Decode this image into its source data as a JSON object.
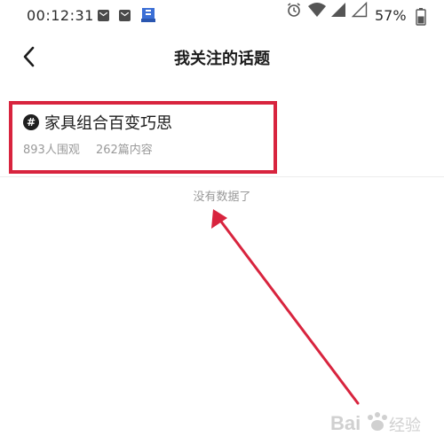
{
  "status_bar": {
    "time": "00:12:31",
    "battery_percent": "57%",
    "notification_icons": [
      "mail-icon",
      "mail-icon",
      "app-icon"
    ]
  },
  "header": {
    "title": "我关注的话题",
    "back_icon": "chevron-left-icon"
  },
  "topics": [
    {
      "title": "家具组合百变巧思",
      "watchers": "893人围观",
      "posts": "262篇内容"
    }
  ],
  "end_of_list_text": "没有数据了",
  "colors": {
    "annotation_red": "#d8243e",
    "muted_text": "#9a9a9a",
    "primary_text": "#1c1c1c"
  },
  "watermark": {
    "text": "Baidu 经验"
  }
}
